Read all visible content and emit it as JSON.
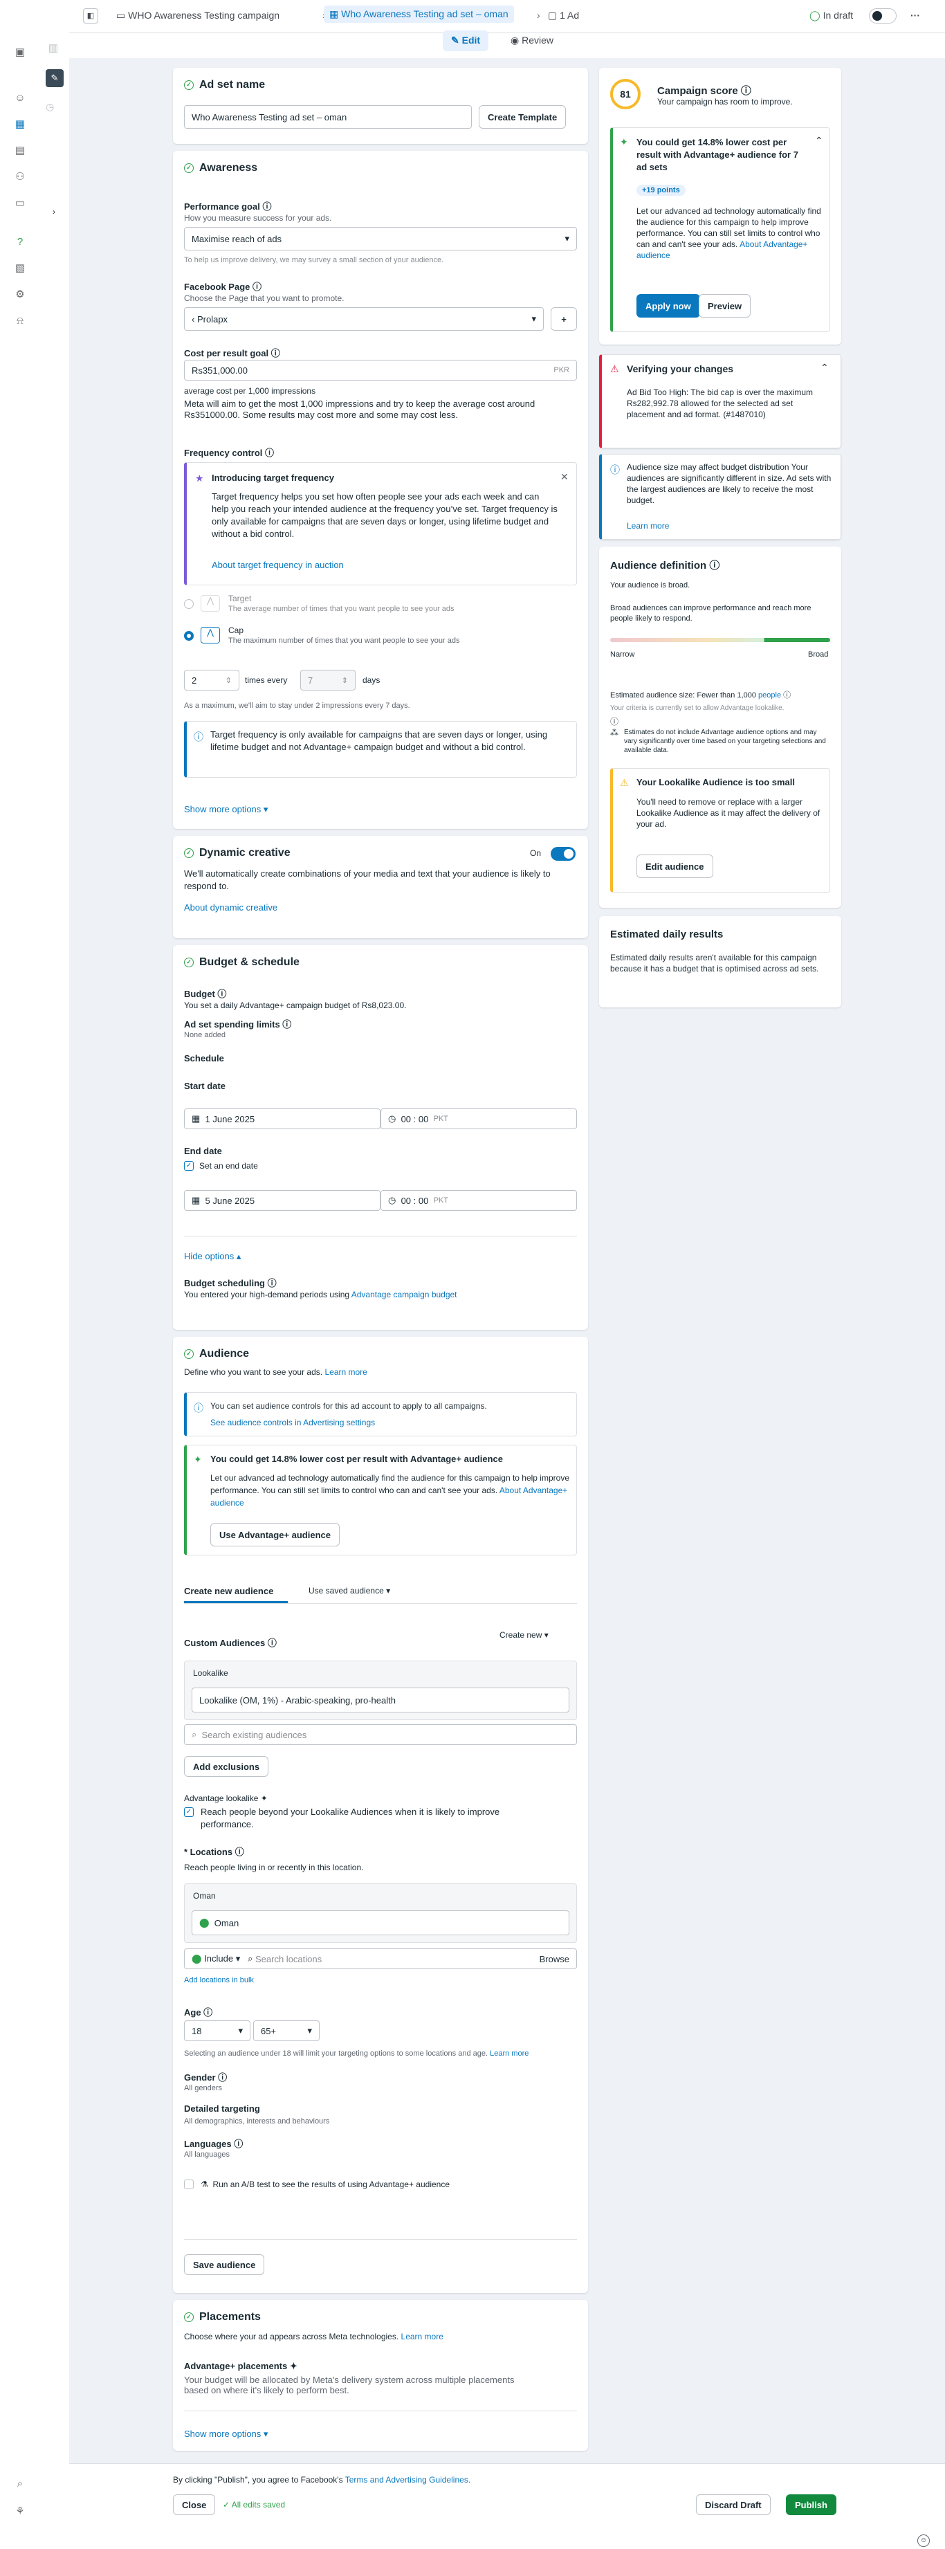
{
  "topbar": {
    "campaign": "WHO Awareness Testing campaign",
    "adset": "Who Awareness Testing ad set – oman",
    "ad": "1 Ad",
    "status": "In draft"
  },
  "subbar": {
    "edit": "Edit",
    "review": "Review"
  },
  "adset_name": {
    "title": "Ad set name",
    "value": "Who Awareness Testing ad set – oman",
    "create_template": "Create Template"
  },
  "awareness": {
    "title": "Awareness",
    "perf_goal_label": "Performance goal",
    "perf_goal_help": "How you measure success for your ads.",
    "perf_goal_value": "Maximise reach of ads",
    "perf_goal_note": "To help us improve delivery, we may survey a small section of your audience.",
    "fb_page_label": "Facebook Page",
    "fb_page_help": "Choose the Page that you want to promote.",
    "fb_page_value": "Prolapx",
    "cost_label": "Cost per result goal",
    "cost_value": "Rs351,000.00",
    "cost_currency": "PKR",
    "cost_sub": "average cost per 1,000 impressions",
    "cost_note": "Meta will aim to get the most 1,000 impressions and try to keep the average cost around Rs351000.00. Some results may cost more and some may cost less.",
    "freq_label": "Frequency control",
    "freq_box_title": "Introducing target frequency",
    "freq_box_text": "Target frequency helps you set how often people see your ads each week and can help you reach your intended audience at the frequency you’ve set. Target frequency is only available for campaigns that are seven days or longer, using lifetime budget and without a bid control.",
    "freq_box_link": "About target frequency in auction",
    "target_title": "Target",
    "target_desc": "The average number of times that you want people to see your ads",
    "cap_title": "Cap",
    "cap_desc": "The maximum number of times that you want people to see your ads",
    "cap_times": "2",
    "times_every": "times every",
    "cap_days": "7",
    "days": "days",
    "cap_note": "As a maximum, we'll aim to stay under 2 impressions every 7 days.",
    "freq_info": "Target frequency is only available for campaigns that are seven days or longer, using lifetime budget and not Advantage+ campaign budget and without a bid control.",
    "show_more": "Show more options ▾"
  },
  "dynamic": {
    "title": "Dynamic creative",
    "on": "On",
    "text": "We'll automatically create combinations of your media and text that your audience is likely to respond to.",
    "link": "About dynamic creative"
  },
  "budget": {
    "title": "Budget & schedule",
    "budget_label": "Budget",
    "budget_text": "You set a daily Advantage+ campaign budget of Rs8,023.00.",
    "limits_label": "Ad set spending limits",
    "limits_text": "None added",
    "schedule_label": "Schedule",
    "start_label": "Start date",
    "start_date": "1 June 2025",
    "start_time": "00 : 00",
    "tz": "PKT",
    "end_label": "End date",
    "end_check": "Set an end date",
    "end_date": "5 June 2025",
    "end_time": "00 : 00",
    "hide": "Hide options ▴",
    "sched_label": "Budget scheduling",
    "sched_text": "You entered your high-demand periods using",
    "sched_link": "Advantage campaign budget"
  },
  "audience": {
    "title": "Audience",
    "subtitle": "Define who you want to see your ads.",
    "learn": "Learn more",
    "info1": "You can set audience controls for this ad account to apply to all campaigns.",
    "info1_link": "See audience controls in Advertising settings",
    "adv_title": "You could get 14.8% lower cost per result with Advantage+ audience",
    "adv_text": "Let our advanced ad technology automatically find the audience for this campaign to help improve performance. You can still set limits to control who can and can't see your ads.",
    "adv_link": "About Advantage+ audience",
    "adv_btn": "Use Advantage+ audience",
    "tab_new": "Create new audience",
    "tab_saved": "Use saved audience ▾",
    "custom_label": "Custom Audiences",
    "create_new": "Create new ▾",
    "lookalike_hdr": "Lookalike",
    "lookalike_value": "Lookalike (OM, 1%) - Arabic-speaking, pro-health",
    "search_placeholder": "Search existing audiences",
    "add_excl": "Add exclusions",
    "adv_lookalike": "Advantage lookalike",
    "adv_lookalike_check": "Reach people beyond your Lookalike Audiences when it is likely to improve performance.",
    "loc_label": "* Locations",
    "loc_help": "Reach people living in or recently in this location.",
    "loc_hdr": "Oman",
    "loc_value": "Oman",
    "include": "Include ▾",
    "loc_search": "Search locations",
    "browse": "Browse",
    "bulk": "Add locations in bulk",
    "age_label": "Age",
    "age_min": "18",
    "age_max": "65+",
    "age_note": "Selecting an audience under 18 will limit your targeting options to some locations and age.",
    "gender_label": "Gender",
    "gender_value": "All genders",
    "detailed_label": "Detailed targeting",
    "detailed_value": "All demographics, interests and behaviours",
    "lang_label": "Languages",
    "lang_value": "All languages",
    "ab_test": "Run an A/B test to see the results of using Advantage+ audience",
    "save": "Save audience"
  },
  "placements": {
    "title": "Placements",
    "text": "Choose where your ad appears across Meta technologies.",
    "learn": "Learn more",
    "adv_label": "Advantage+ placements",
    "adv_text": "Your budget will be allocated by Meta's delivery system across multiple placements based on where it's likely to perform best.",
    "show_more": "Show more options ▾"
  },
  "score": {
    "value": "81",
    "title": "Campaign score",
    "subtitle": "Your campaign has room to improve.",
    "tip_title": "You could get 14.8% lower cost per result with Advantage+ audience for 7 ad sets",
    "points": "+19 points",
    "tip_text": "Let our advanced ad technology automatically find the audience for this campaign to help improve performance. You can still set limits to control who can and can't see your ads.",
    "tip_link": "About Advantage+ audience",
    "apply": "Apply now",
    "preview": "Preview"
  },
  "verify": {
    "title": "Verifying your changes",
    "err": "Ad Bid Too High: The bid cap is over the maximum Rs282,992.78 allowed for the selected ad set placement and ad format. (#1487010)",
    "info": "Audience size may affect budget distribution Your audiences are significantly different in size. Ad sets with the largest audiences are likely to receive the most budget.",
    "learn": "Learn more"
  },
  "definition": {
    "title": "Audience definition",
    "broad_status": "Your audience is broad.",
    "text": "Broad audiences can improve performance and reach more people likely to respond.",
    "narrow": "Narrow",
    "broad": "Broad",
    "est_size": "Estimated audience size: Fewer than 1,000",
    "people": "people",
    "criteria": "Your criteria is currently set to allow Advantage lookalike.",
    "estimates": "Estimates do not include Advantage audience options and may vary significantly over time based on your targeting selections and available data.",
    "warn_title": "Your Lookalike Audience is too small",
    "warn_text": "You'll need to remove or replace with a larger Lookalike Audience as it may affect the delivery of your ad.",
    "edit": "Edit audience"
  },
  "daily": {
    "title": "Estimated daily results",
    "text": "Estimated daily results aren't available for this campaign because it has a budget that is optimised across ad sets."
  },
  "footer": {
    "terms_prefix": "By clicking \"Publish\", you agree to Facebook's",
    "terms_link": "Terms and Advertising Guidelines.",
    "close": "Close",
    "saved": "All edits saved",
    "discard": "Discard Draft",
    "publish": "Publish"
  },
  "colors": {
    "accent": "#0a78be",
    "success": "#31a24c",
    "error": "#e41e3f",
    "warning": "#f7b928",
    "publish": "#118a3e"
  }
}
